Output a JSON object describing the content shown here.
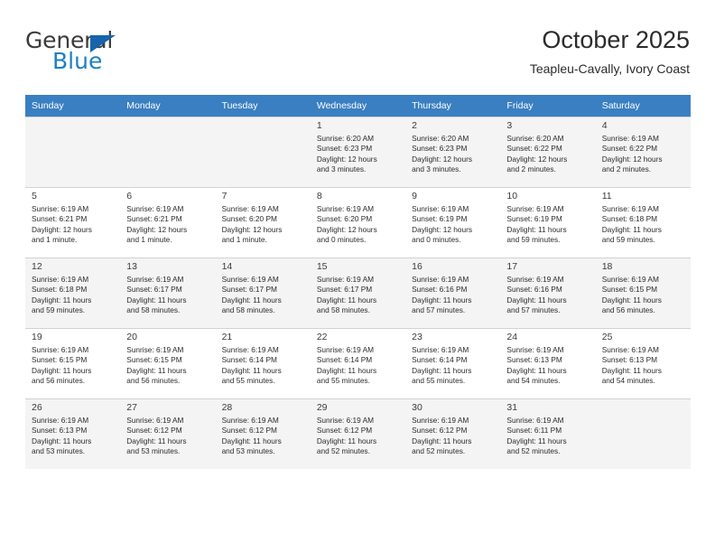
{
  "brand": {
    "name_top": "General",
    "name_bottom": "Blue",
    "triangle_color": "#1664ac",
    "blue_color": "#1c7fc4"
  },
  "header": {
    "title": "October 2025",
    "subtitle": "Teapleu-Cavally, Ivory Coast"
  },
  "theme": {
    "header_bg": "#3a7fc1",
    "header_text": "#ffffff",
    "row_alt_bg": "#f4f4f4",
    "grid_line": "#d2d2d2"
  },
  "weekdays": [
    "Sunday",
    "Monday",
    "Tuesday",
    "Wednesday",
    "Thursday",
    "Friday",
    "Saturday"
  ],
  "labels": {
    "sunrise_prefix": "Sunrise:",
    "sunset_prefix": "Sunset:",
    "daylight_prefix": "Daylight:"
  },
  "weeks": [
    [
      {
        "day": "",
        "l1": "",
        "l2": "",
        "l3": "",
        "l4": ""
      },
      {
        "day": "",
        "l1": "",
        "l2": "",
        "l3": "",
        "l4": ""
      },
      {
        "day": "",
        "l1": "",
        "l2": "",
        "l3": "",
        "l4": ""
      },
      {
        "day": "1",
        "l1": "Sunrise: 6:20 AM",
        "l2": "Sunset: 6:23 PM",
        "l3": "Daylight: 12 hours",
        "l4": "and 3 minutes."
      },
      {
        "day": "2",
        "l1": "Sunrise: 6:20 AM",
        "l2": "Sunset: 6:23 PM",
        "l3": "Daylight: 12 hours",
        "l4": "and 3 minutes."
      },
      {
        "day": "3",
        "l1": "Sunrise: 6:20 AM",
        "l2": "Sunset: 6:22 PM",
        "l3": "Daylight: 12 hours",
        "l4": "and 2 minutes."
      },
      {
        "day": "4",
        "l1": "Sunrise: 6:19 AM",
        "l2": "Sunset: 6:22 PM",
        "l3": "Daylight: 12 hours",
        "l4": "and 2 minutes."
      }
    ],
    [
      {
        "day": "5",
        "l1": "Sunrise: 6:19 AM",
        "l2": "Sunset: 6:21 PM",
        "l3": "Daylight: 12 hours",
        "l4": "and 1 minute."
      },
      {
        "day": "6",
        "l1": "Sunrise: 6:19 AM",
        "l2": "Sunset: 6:21 PM",
        "l3": "Daylight: 12 hours",
        "l4": "and 1 minute."
      },
      {
        "day": "7",
        "l1": "Sunrise: 6:19 AM",
        "l2": "Sunset: 6:20 PM",
        "l3": "Daylight: 12 hours",
        "l4": "and 1 minute."
      },
      {
        "day": "8",
        "l1": "Sunrise: 6:19 AM",
        "l2": "Sunset: 6:20 PM",
        "l3": "Daylight: 12 hours",
        "l4": "and 0 minutes."
      },
      {
        "day": "9",
        "l1": "Sunrise: 6:19 AM",
        "l2": "Sunset: 6:19 PM",
        "l3": "Daylight: 12 hours",
        "l4": "and 0 minutes."
      },
      {
        "day": "10",
        "l1": "Sunrise: 6:19 AM",
        "l2": "Sunset: 6:19 PM",
        "l3": "Daylight: 11 hours",
        "l4": "and 59 minutes."
      },
      {
        "day": "11",
        "l1": "Sunrise: 6:19 AM",
        "l2": "Sunset: 6:18 PM",
        "l3": "Daylight: 11 hours",
        "l4": "and 59 minutes."
      }
    ],
    [
      {
        "day": "12",
        "l1": "Sunrise: 6:19 AM",
        "l2": "Sunset: 6:18 PM",
        "l3": "Daylight: 11 hours",
        "l4": "and 59 minutes."
      },
      {
        "day": "13",
        "l1": "Sunrise: 6:19 AM",
        "l2": "Sunset: 6:17 PM",
        "l3": "Daylight: 11 hours",
        "l4": "and 58 minutes."
      },
      {
        "day": "14",
        "l1": "Sunrise: 6:19 AM",
        "l2": "Sunset: 6:17 PM",
        "l3": "Daylight: 11 hours",
        "l4": "and 58 minutes."
      },
      {
        "day": "15",
        "l1": "Sunrise: 6:19 AM",
        "l2": "Sunset: 6:17 PM",
        "l3": "Daylight: 11 hours",
        "l4": "and 58 minutes."
      },
      {
        "day": "16",
        "l1": "Sunrise: 6:19 AM",
        "l2": "Sunset: 6:16 PM",
        "l3": "Daylight: 11 hours",
        "l4": "and 57 minutes."
      },
      {
        "day": "17",
        "l1": "Sunrise: 6:19 AM",
        "l2": "Sunset: 6:16 PM",
        "l3": "Daylight: 11 hours",
        "l4": "and 57 minutes."
      },
      {
        "day": "18",
        "l1": "Sunrise: 6:19 AM",
        "l2": "Sunset: 6:15 PM",
        "l3": "Daylight: 11 hours",
        "l4": "and 56 minutes."
      }
    ],
    [
      {
        "day": "19",
        "l1": "Sunrise: 6:19 AM",
        "l2": "Sunset: 6:15 PM",
        "l3": "Daylight: 11 hours",
        "l4": "and 56 minutes."
      },
      {
        "day": "20",
        "l1": "Sunrise: 6:19 AM",
        "l2": "Sunset: 6:15 PM",
        "l3": "Daylight: 11 hours",
        "l4": "and 56 minutes."
      },
      {
        "day": "21",
        "l1": "Sunrise: 6:19 AM",
        "l2": "Sunset: 6:14 PM",
        "l3": "Daylight: 11 hours",
        "l4": "and 55 minutes."
      },
      {
        "day": "22",
        "l1": "Sunrise: 6:19 AM",
        "l2": "Sunset: 6:14 PM",
        "l3": "Daylight: 11 hours",
        "l4": "and 55 minutes."
      },
      {
        "day": "23",
        "l1": "Sunrise: 6:19 AM",
        "l2": "Sunset: 6:14 PM",
        "l3": "Daylight: 11 hours",
        "l4": "and 55 minutes."
      },
      {
        "day": "24",
        "l1": "Sunrise: 6:19 AM",
        "l2": "Sunset: 6:13 PM",
        "l3": "Daylight: 11 hours",
        "l4": "and 54 minutes."
      },
      {
        "day": "25",
        "l1": "Sunrise: 6:19 AM",
        "l2": "Sunset: 6:13 PM",
        "l3": "Daylight: 11 hours",
        "l4": "and 54 minutes."
      }
    ],
    [
      {
        "day": "26",
        "l1": "Sunrise: 6:19 AM",
        "l2": "Sunset: 6:13 PM",
        "l3": "Daylight: 11 hours",
        "l4": "and 53 minutes."
      },
      {
        "day": "27",
        "l1": "Sunrise: 6:19 AM",
        "l2": "Sunset: 6:12 PM",
        "l3": "Daylight: 11 hours",
        "l4": "and 53 minutes."
      },
      {
        "day": "28",
        "l1": "Sunrise: 6:19 AM",
        "l2": "Sunset: 6:12 PM",
        "l3": "Daylight: 11 hours",
        "l4": "and 53 minutes."
      },
      {
        "day": "29",
        "l1": "Sunrise: 6:19 AM",
        "l2": "Sunset: 6:12 PM",
        "l3": "Daylight: 11 hours",
        "l4": "and 52 minutes."
      },
      {
        "day": "30",
        "l1": "Sunrise: 6:19 AM",
        "l2": "Sunset: 6:12 PM",
        "l3": "Daylight: 11 hours",
        "l4": "and 52 minutes."
      },
      {
        "day": "31",
        "l1": "Sunrise: 6:19 AM",
        "l2": "Sunset: 6:11 PM",
        "l3": "Daylight: 11 hours",
        "l4": "and 52 minutes."
      },
      {
        "day": "",
        "l1": "",
        "l2": "",
        "l3": "",
        "l4": ""
      }
    ]
  ]
}
